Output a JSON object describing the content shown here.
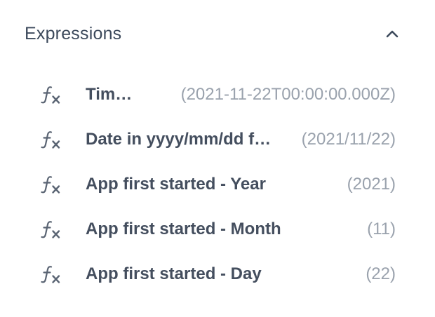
{
  "section": {
    "title": "Expressions",
    "collapse_icon": "chevron-up-icon",
    "colors": {
      "title": "#3d4a5c",
      "label": "#444e5e",
      "value": "#9aa2ad",
      "icon": "#5a6473"
    }
  },
  "expressions": [
    {
      "icon": "function-icon",
      "label": "Timestamp",
      "value": "(2021-11-22T00:00:00.000Z)"
    },
    {
      "icon": "function-icon",
      "label": "Date in yyyy/mm/dd format",
      "value": "(2021/11/22)"
    },
    {
      "icon": "function-icon",
      "label": "App first started - Year",
      "value": "(2021)"
    },
    {
      "icon": "function-icon",
      "label": "App first started - Month",
      "value": "(11)"
    },
    {
      "icon": "function-icon",
      "label": "App first started - Day",
      "value": "(22)"
    }
  ]
}
